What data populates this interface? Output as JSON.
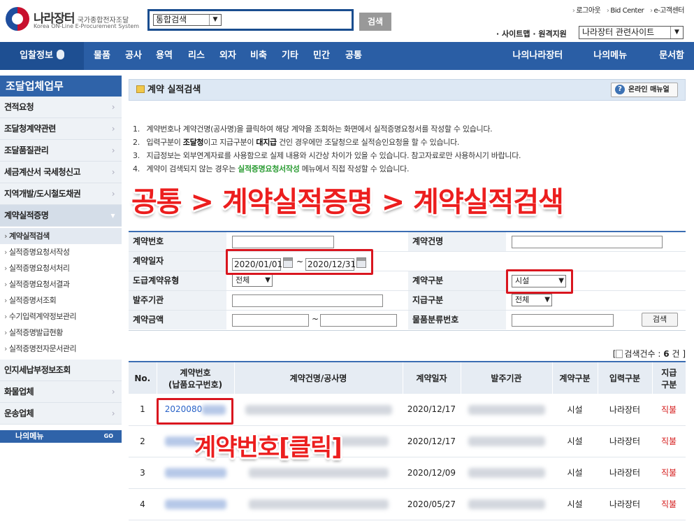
{
  "header": {
    "logo_kr": "나라장터",
    "logo_kr_sub": "국가종합전자조달",
    "logo_en": "Korea ON-Line E-Procurement System",
    "search_scope": "통합검색",
    "search_button": "검색",
    "top_links": [
      "로그아웃",
      "Bid Center",
      "e-고객센터"
    ],
    "util_links": "· 사이트맵 · 원격지원",
    "site_select": "나라장터 관련사이트"
  },
  "nav": {
    "first": "입찰정보",
    "items": [
      "물품",
      "공사",
      "용역",
      "리스",
      "외자",
      "비축",
      "기타",
      "민간",
      "공통"
    ],
    "right": [
      "나의나라장터",
      "나의메뉴",
      "문서함"
    ]
  },
  "sidebar": {
    "title": "조달업체업무",
    "items_top": [
      "견적요청",
      "조달청계약관련",
      "조달품질관리",
      "세금계산서 국세청신고",
      "지역개발/도시철도채권"
    ],
    "active_item": "계약실적증명",
    "sub_items": [
      "계약실적검색",
      "실적증명요청서작성",
      "실적증명요청서처리",
      "실적증명요청서결과",
      "실적증명서조회",
      "수기입력계약정보관리",
      "실적증명발급현황",
      "실적증명전자문서관리"
    ],
    "items_bottom": [
      "인지세납부정보조회",
      "화물업체",
      "운송업체"
    ],
    "my_menu": "나의메뉴",
    "my_menu_go": "GO"
  },
  "page": {
    "title": "계약 실적검색",
    "manual_button": "온라인 매뉴얼",
    "notes": [
      {
        "n": "1.",
        "a": "계약번호나 계약건명(공사명)을 클릭하여 해당 계약을 조회하는 화면에서 실적증명요청서를 작성할 수 있습니다.",
        "b": "",
        "c": "",
        "d": "",
        "e": ""
      },
      {
        "n": "2.",
        "a": "입력구분이 ",
        "b": "조달청",
        "c": "이고 지급구분이 ",
        "d": "대지급",
        "e": " 건인 경우에만 조달청으로 실적승인요청을 할 수 있습니다."
      },
      {
        "n": "3.",
        "a": "지급정보는 외부연계자료를 사용함으로 실제 내용와 시간상 차이가 있을 수 있습니다. 참고자료로만 사용하시기 바랍니다.",
        "b": "",
        "c": "",
        "d": "",
        "e": ""
      },
      {
        "n": "4.",
        "a": "계약이 검색되지 않는 경우는 ",
        "b": "",
        "c": "",
        "d": "실적증명요청서작성",
        "e": " 메뉴에서 직접 작성할 수 있습니다."
      }
    ],
    "overlay_path": "공통 > 계약실적증명 > 계약실적검색",
    "overlay_click": "계약번호[클릭]"
  },
  "form": {
    "contract_no_label": "계약번호",
    "contract_name_label": "계약건명",
    "contract_date_label": "계약일자",
    "date_from": "2020/01/01",
    "date_to": "2020/12/31",
    "tilde": "~",
    "sub_type_label": "도급계약유형",
    "sub_type_value": "전체",
    "contract_type_label": "계약구분",
    "contract_type_value": "시설",
    "ordering_org_label": "발주기관",
    "payment_type_label": "지급구분",
    "payment_type_value": "전체",
    "amount_label": "계약금액",
    "goods_class_label": "물품분류번호",
    "search_button": "검색"
  },
  "results": {
    "count_prefix": "검색건수 : ",
    "count": "6",
    "count_suffix": " 건",
    "bracket_open": "[",
    "bracket_close": "]",
    "columns": {
      "no": "No.",
      "contract_no_line1": "계약번호",
      "contract_no_line2": "(납품요구번호)",
      "name": "계약건명/공사명",
      "date": "계약일자",
      "org": "발주기관",
      "type": "계약구분",
      "input": "입력구분",
      "pay_line1": "지급",
      "pay_line2": "구분"
    },
    "rows": [
      {
        "no": "1",
        "contract_no": "2020080",
        "date": "2020/12/17",
        "type": "시설",
        "input": "나라장터",
        "pay": "직불"
      },
      {
        "no": "2",
        "contract_no": "",
        "date": "2020/12/17",
        "type": "시설",
        "input": "나라장터",
        "pay": "직불"
      },
      {
        "no": "3",
        "contract_no": "",
        "date": "2020/12/09",
        "type": "시설",
        "input": "나라장터",
        "pay": "직불"
      },
      {
        "no": "4",
        "contract_no": "",
        "date": "2020/05/27",
        "type": "시설",
        "input": "나라장터",
        "pay": "직불"
      }
    ]
  },
  "colors": {
    "nav": "#2a5ea5",
    "accent_red": "#d9161f",
    "link_blue": "#2a63c8",
    "note_green": "#2c9c34"
  }
}
